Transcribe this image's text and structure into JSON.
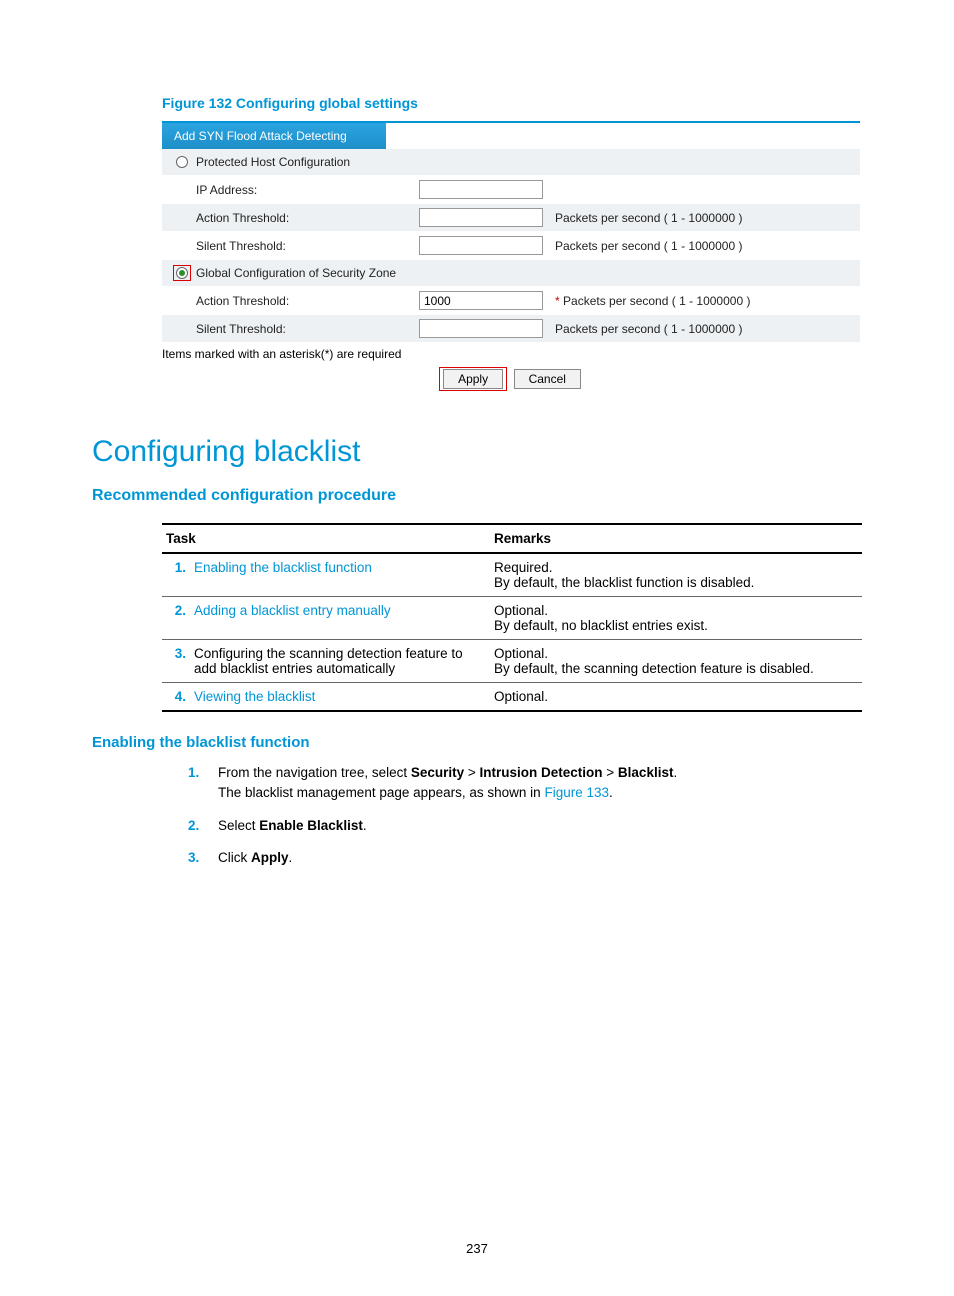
{
  "figcap": "Figure 132 Configuring global settings",
  "tab": "Add SYN Flood Attack Detecting",
  "rows": {
    "protected": "Protected Host Configuration",
    "ip": "IP Address:",
    "action1": "Action Threshold:",
    "silent1": "Silent Threshold:",
    "global": "Global Configuration of Security Zone",
    "action2": "Action Threshold:",
    "silent2": "Silent Threshold:"
  },
  "vals": {
    "action2": "1000"
  },
  "hints": {
    "pps": "Packets per second ( 1 - 1000000 )",
    "req": "*"
  },
  "note": "Items marked with an asterisk(*) are required",
  "btns": {
    "apply": "Apply",
    "cancel": "Cancel"
  },
  "h1": "Configuring blacklist",
  "h2": "Recommended configuration procedure",
  "th": {
    "task": "Task",
    "remarks": "Remarks"
  },
  "tasks": [
    {
      "n": "1.",
      "t": "Enabling the blacklist function",
      "link": true,
      "r1": "Required.",
      "r2": "By default, the blacklist function is disabled."
    },
    {
      "n": "2.",
      "t": "Adding a blacklist entry manually",
      "link": true,
      "r1": "Optional.",
      "r2": "By default, no blacklist entries exist."
    },
    {
      "n": "3.",
      "t": "Configuring the scanning detection feature to add blacklist entries automatically",
      "link": false,
      "r1": "Optional.",
      "r2": "By default, the scanning detection feature is disabled."
    },
    {
      "n": "4.",
      "t": "Viewing the blacklist",
      "link": true,
      "r1": "Optional.",
      "r2": ""
    }
  ],
  "h3": "Enabling the blacklist function",
  "steps": {
    "s1a": "From the navigation tree, select ",
    "s1b": "Security",
    "s1c": " > ",
    "s1d": "Intrusion Detection",
    "s1e": " > ",
    "s1f": "Blacklist",
    "s1g": ".",
    "s1h": "The blacklist management page appears, as shown in ",
    "s1i": "Figure 133",
    "s1j": ".",
    "s2a": "Select ",
    "s2b": "Enable Blacklist",
    "s2c": ".",
    "s3a": "Click ",
    "s3b": "Apply",
    "s3c": "."
  },
  "pagenum": "237"
}
